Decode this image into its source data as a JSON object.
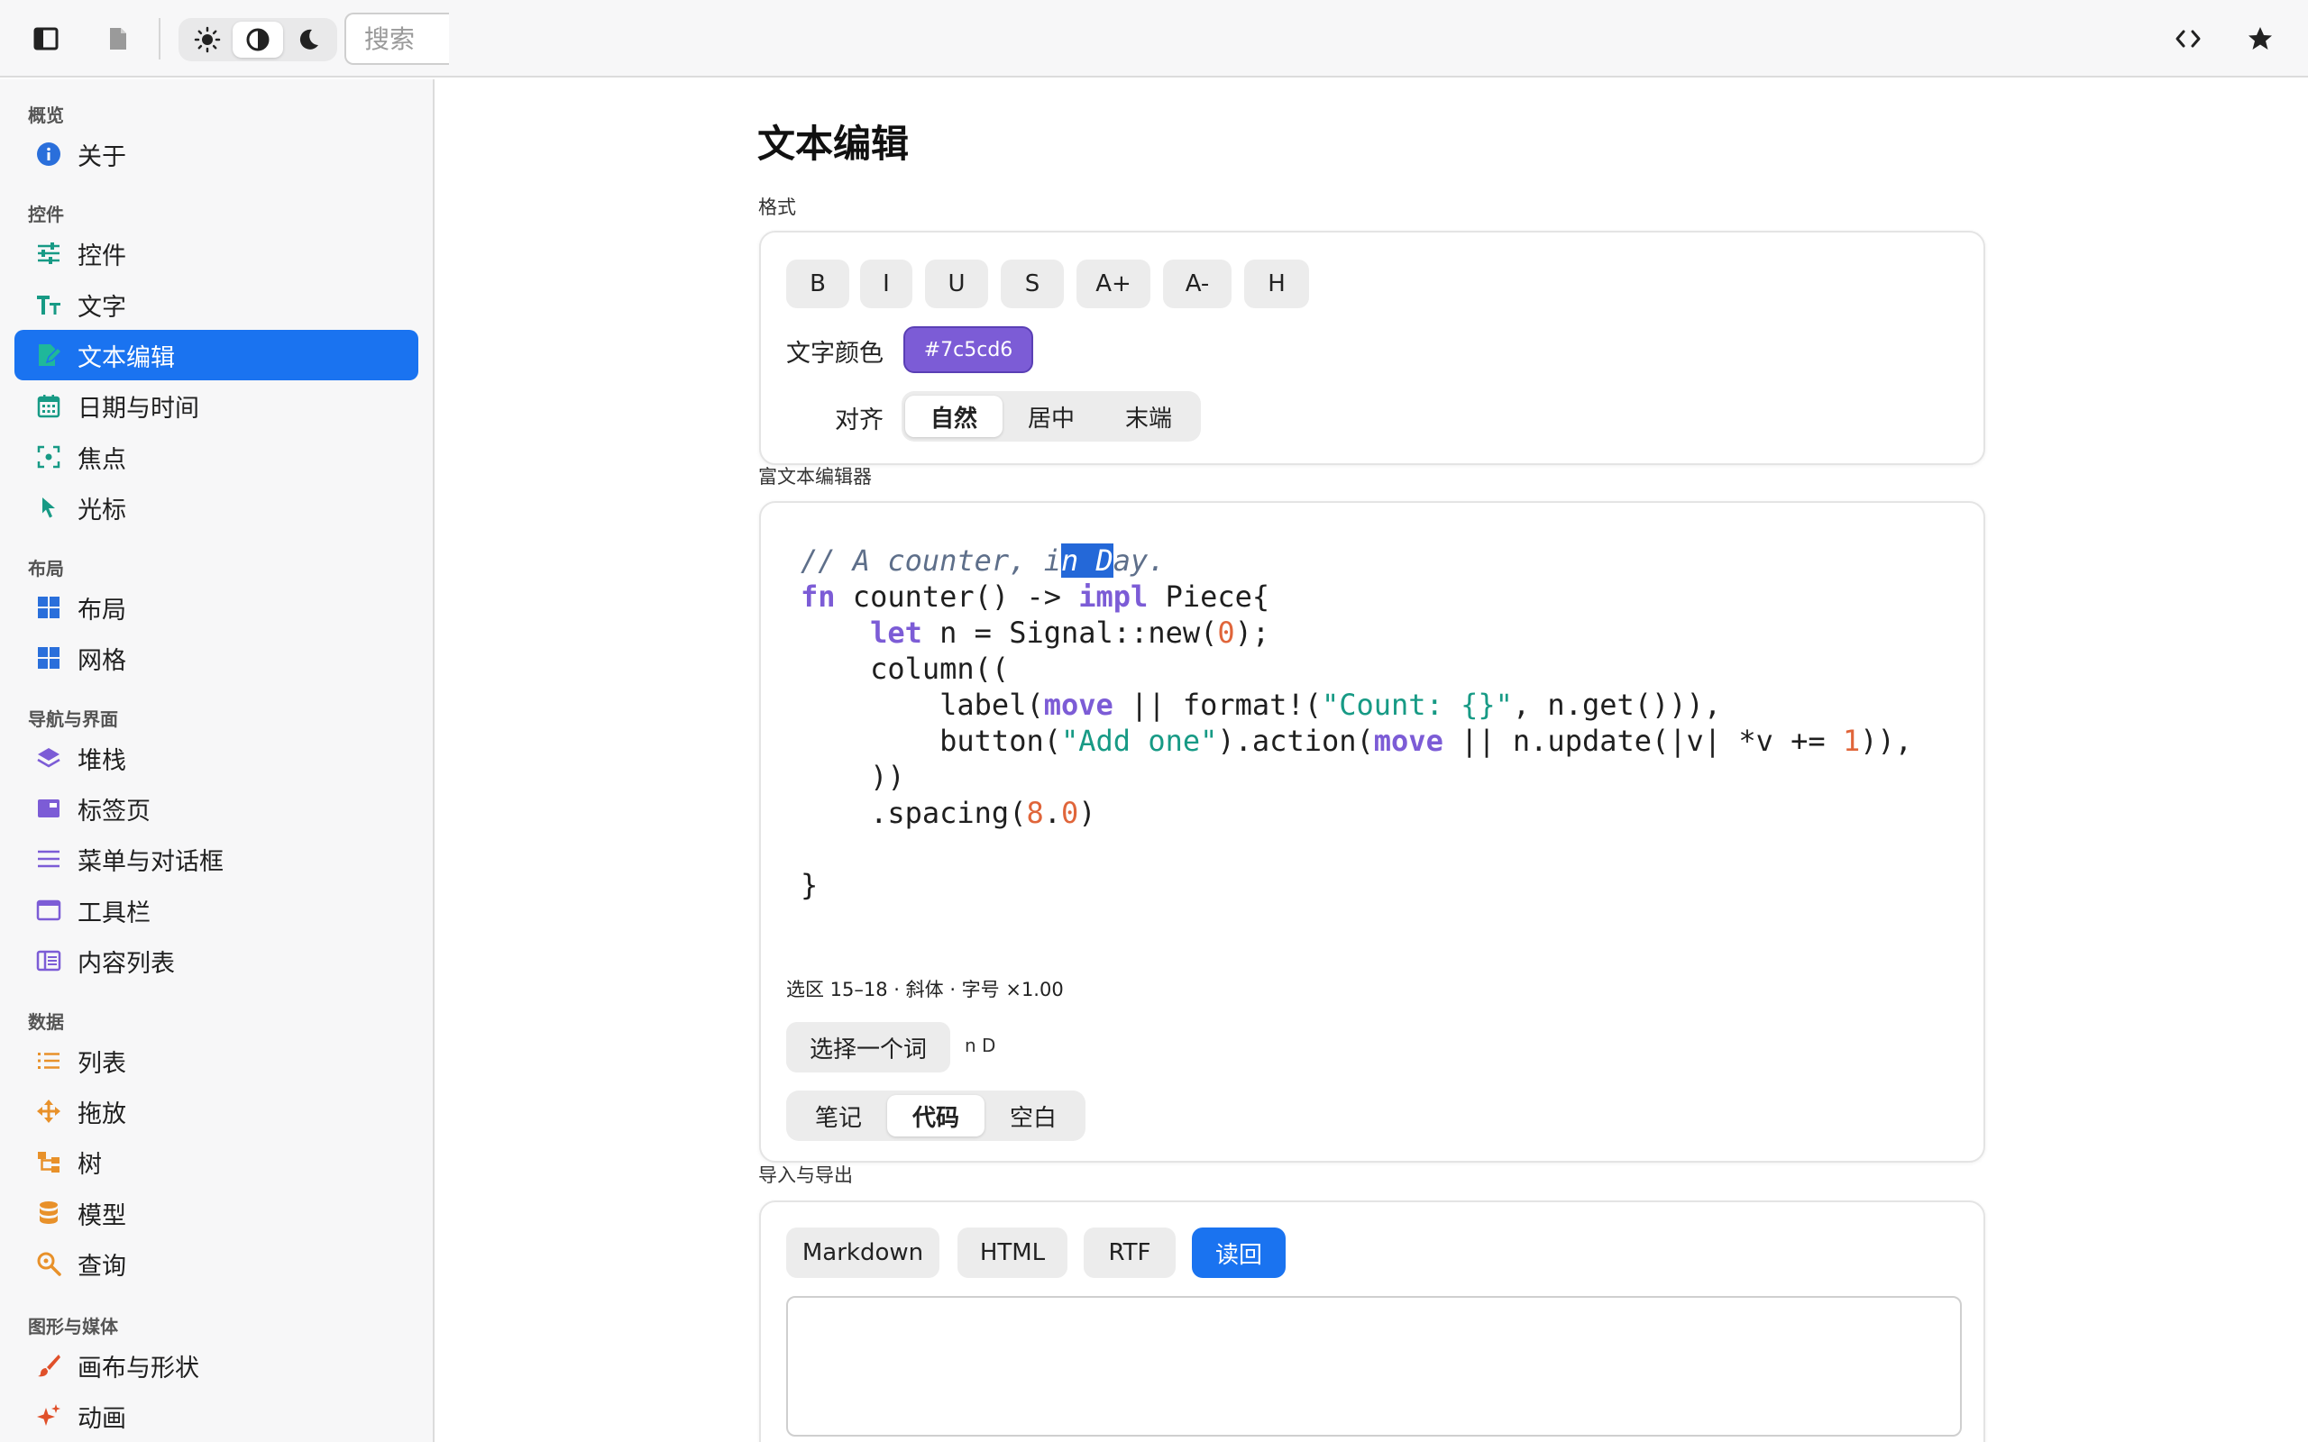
{
  "toolbar": {
    "search_placeholder": "搜索",
    "theme_options": [
      "light",
      "auto",
      "dark"
    ],
    "selected_theme": "auto"
  },
  "sidebar": {
    "sections": {
      "overview": "概览",
      "controls": "控件",
      "layout": "布局",
      "nav": "导航与界面",
      "data": "数据",
      "media": "图形与媒体"
    },
    "items": {
      "about": "关于",
      "controls": "控件",
      "text": "文字",
      "text_editing": "文本编辑",
      "datetime": "日期与时间",
      "focus": "焦点",
      "cursor": "光标",
      "layout": "布局",
      "grid": "网格",
      "stack": "堆栈",
      "tabs": "标签页",
      "menus": "菜单与对话框",
      "toolbar": "工具栏",
      "content_list": "内容列表",
      "list": "列表",
      "drag_drop": "拖放",
      "tree": "树",
      "model": "模型",
      "query": "查询",
      "canvas": "画布与形状",
      "animation": "动画"
    },
    "active": "text_editing"
  },
  "main": {
    "title": "文本编辑",
    "format": {
      "label": "格式",
      "buttons": [
        "B",
        "I",
        "U",
        "S",
        "A+",
        "A-",
        "H"
      ],
      "color_label": "文字颜色",
      "color_value": "#7c5cd6",
      "align_label": "对齐",
      "align_options": [
        "自然",
        "居中",
        "末端"
      ],
      "align_selected": 0
    },
    "rich": {
      "label": "富文本编辑器",
      "code": {
        "l1a": "// A counter, i",
        "l1sel": "n D",
        "l1b": "ay.",
        "fn": "fn",
        "sig": " counter() -> ",
        "impl": "impl",
        "piece": " Piece{",
        "indent4": "    ",
        "let": "let",
        "l3b": " n = Signal::new(",
        "zero": "0",
        "l3c": ");",
        "l4": "    column((",
        "indent8": "        ",
        "label_open": "label(",
        "move": "move",
        "l5b": " || format!(",
        "count_str": "\"Count: {}\"",
        "l5c": ", n.get())),",
        "button_open": "button(",
        "add_str": "\"Add one\"",
        "l6b": ").action(",
        "l6c": " || n.update(|v| *v += ",
        "one": "1",
        "l6d": ")),",
        "l7": "    ))",
        "l8a": "    .spacing(",
        "eight": "8",
        "dot": ".",
        "l8c": ")",
        "l9": "",
        "l10": "}"
      },
      "status": "选区 15–18 · 斜体 · 字号 ×1.00",
      "select_word": "选择一个词",
      "selected_text": "n D",
      "mode_options": [
        "笔记",
        "代码",
        "空白"
      ],
      "mode_selected": 1
    },
    "export": {
      "label": "导入与导出",
      "buttons": [
        "Markdown",
        "HTML",
        "RTF"
      ],
      "readback": "读回",
      "content": ""
    }
  },
  "colors": {
    "accent": "#1a73f0",
    "purple": "#7c5cd6",
    "teal": "#179a85",
    "orange": "#e8912a"
  }
}
